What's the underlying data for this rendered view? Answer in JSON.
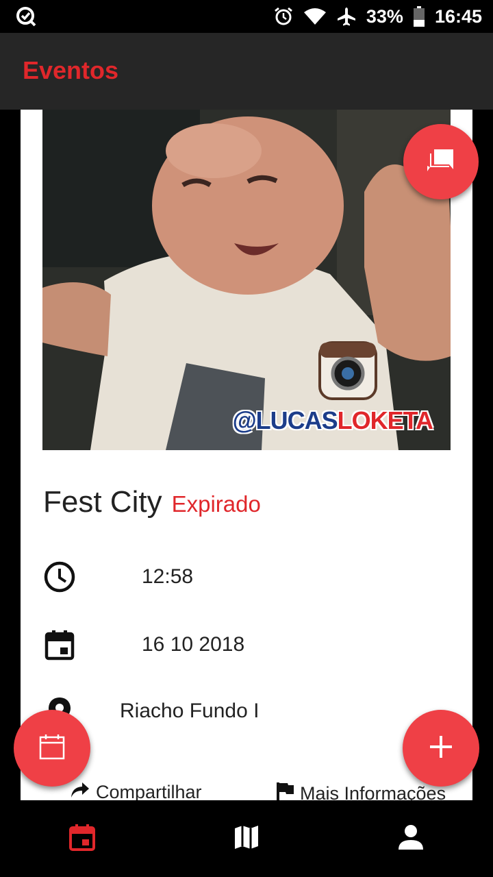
{
  "status_bar": {
    "battery": "33%",
    "time": "16:45",
    "icons": [
      "notification-app-icon",
      "alarm-icon",
      "wifi-icon",
      "airplane-icon",
      "battery-icon"
    ]
  },
  "app_bar": {
    "title": "Eventos"
  },
  "event": {
    "watermark_part1": "@LUCAS",
    "watermark_part2": "LOKETA",
    "name": "Fest City",
    "status": "Expirado",
    "time": "12:58",
    "date": "16 10 2018",
    "location": "Riacho Fundo I"
  },
  "actions": {
    "share_label": "Compartilhar",
    "more_info_label": "Mais Informações"
  },
  "colors": {
    "accent": "#e0272b",
    "fab": "#ef4046",
    "app_bar_bg": "#262626"
  },
  "bottom_nav": {
    "items": [
      "events-calendar-icon",
      "map-icon",
      "profile-icon"
    ],
    "active": "events-calendar-icon"
  }
}
